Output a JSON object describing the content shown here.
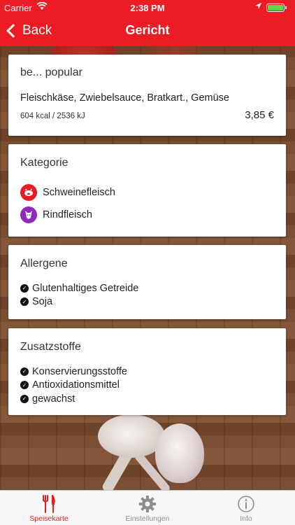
{
  "status_bar": {
    "carrier": "Carrier",
    "time": "2:38 PM",
    "battery_level": 1.0,
    "battery_color": "#58d94a"
  },
  "nav": {
    "back_label": "Back",
    "title": "Gericht",
    "bar_color": "#ec1c24"
  },
  "dish": {
    "name": "be... popular",
    "description": "Fleischkäse, Zwiebelsauce, Bratkart., Gemüse",
    "energy": "604 kcal / 2536 kJ",
    "price": "3,85 €"
  },
  "category": {
    "heading": "Kategorie",
    "items": [
      {
        "label": "Schweinefleisch",
        "icon": "pig-icon",
        "color": "#e31e24"
      },
      {
        "label": "Rindfleisch",
        "icon": "cow-icon",
        "color": "#8e2bbd"
      }
    ]
  },
  "allergens": {
    "heading": "Allergene",
    "items": [
      "Glutenhaltiges Getreide",
      "Soja"
    ]
  },
  "additives": {
    "heading": "Zusatzstoffe",
    "items": [
      "Konservierungsstoffe",
      "Antioxidationsmittel",
      "gewachst"
    ]
  },
  "tabs": [
    {
      "label": "Speisekarte",
      "icon": "fork-knife-icon",
      "active": true
    },
    {
      "label": "Einstellungen",
      "icon": "gear-icon",
      "active": false
    },
    {
      "label": "Info",
      "icon": "info-icon",
      "active": false
    }
  ]
}
